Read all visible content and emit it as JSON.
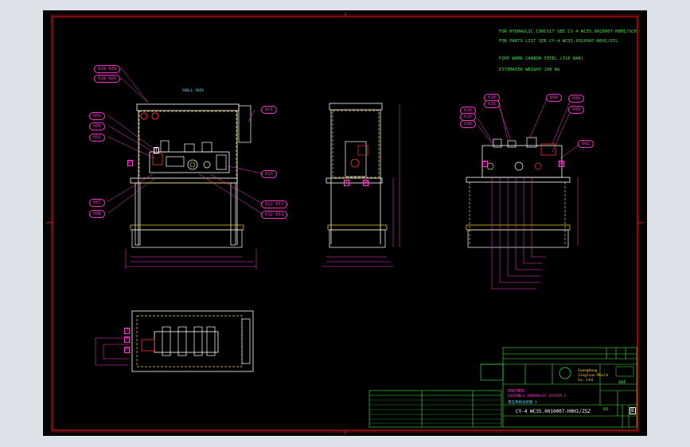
{
  "notes": [
    "FOR HYDRAULIC CIRCUIT SEE  CY-4 WC35.0010007-H0H1/SCH",
    "FOR PARTS LIST SEE  CY-4 WC35.0010007-H0H1/STL",
    "PIPE WORK CARBON STEEL (310 BAR)",
    "ESTIMATED WEIGHT   100 KG"
  ],
  "front_view_labels": [
    "019  020",
    "019  020",
    "003",
    "005",
    "001",
    "007",
    "008",
    "021",
    "017",
    "012  013",
    "012  013"
  ],
  "side_view_labels": [
    "010",
    "015",
    "016",
    "015",
    "016",
    "004",
    "006",
    "009",
    "002"
  ],
  "port_letters": [
    "P",
    "T",
    "T",
    "P",
    "T",
    "P",
    "T",
    "T",
    "P"
  ],
  "frame_label": "SHELL 5656",
  "title_block": {
    "company": "Guangdong Jinglian Mould Co. Ltd",
    "logo_text": "VAI",
    "sheet_size": "A3",
    "revision": "B",
    "drawing_number": "CY-4 WC35.0010007-H0H1/ZSZ",
    "project": "PRECMED",
    "description": "ASSEMBLY HYDRAULIC SYSTEM 1",
    "description_cn": "液压系统总装图 1"
  },
  "colors": {
    "sheet": "#000000",
    "border": "#ff1a1a",
    "outline": "#ffffff",
    "hidden": "#ffd92b",
    "dims": "#ff3ad6",
    "text": "#3ef23e",
    "accent": "#5fe0ff"
  }
}
